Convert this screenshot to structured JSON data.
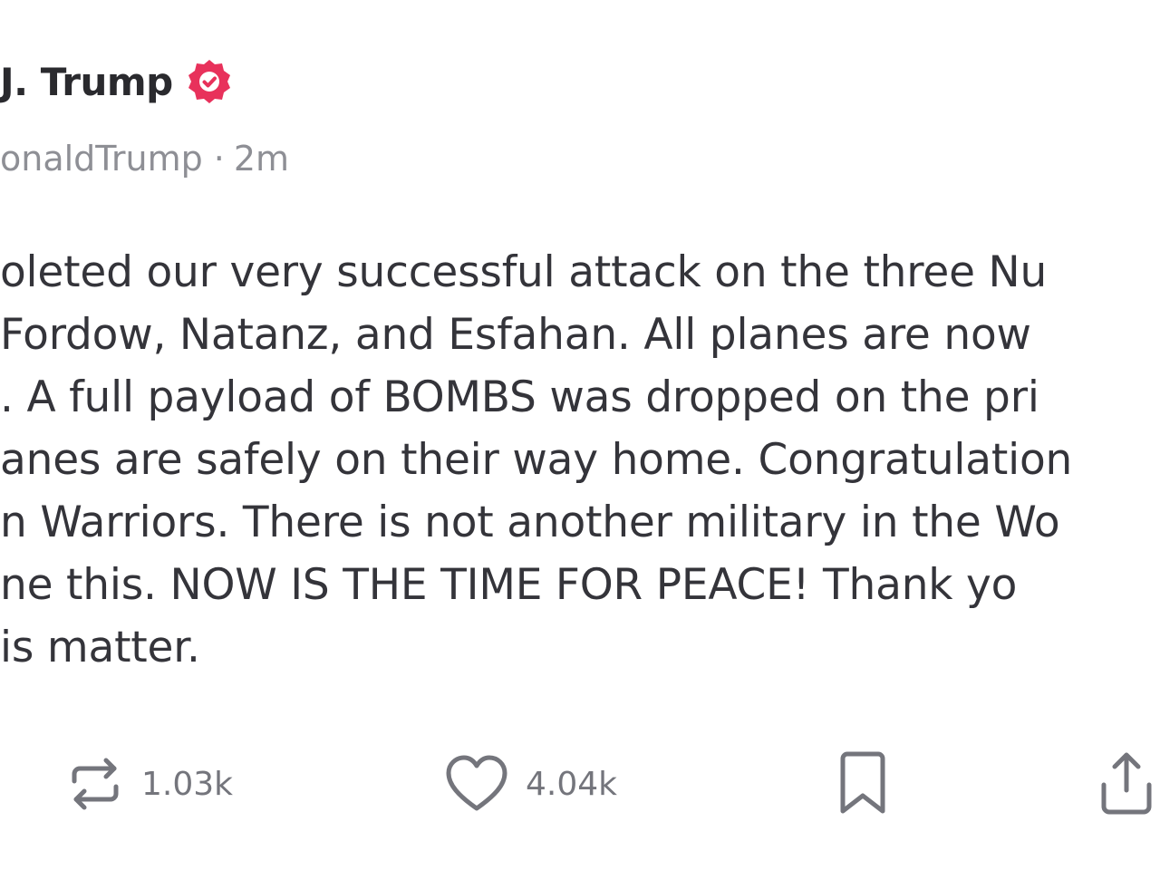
{
  "author": {
    "name": "J. Trump",
    "handle": "onaldTrump",
    "separator": "·",
    "time": "2m",
    "verified_color": "#e8315b"
  },
  "post": {
    "lines": [
      "oleted our very successful attack on the three Nu",
      "Fordow, Natanz, and Esfahan. All planes are now",
      ". A full payload of BOMBS was dropped on the pri",
      "anes are safely on their way home. Congratulation",
      "n Warriors. There is not another military in the Wo",
      "ne this. NOW IS THE TIME FOR PEACE! Thank yo",
      "is matter."
    ]
  },
  "actions": {
    "repost_icon": "repost-icon",
    "repost_count": "1.03k",
    "like_icon": "heart-icon",
    "like_count": "4.04k",
    "bookmark_icon": "bookmark-icon",
    "share_icon": "share-icon"
  }
}
